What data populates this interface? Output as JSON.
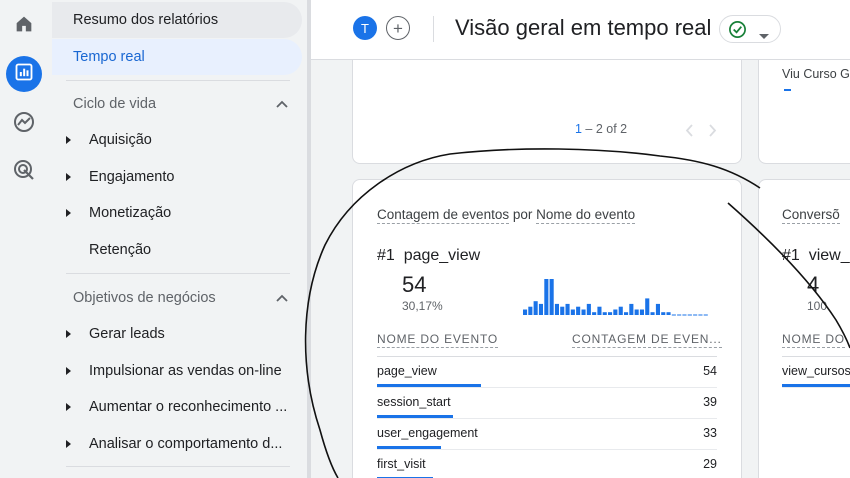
{
  "rail": {
    "items": [
      {
        "name": "home-icon",
        "active": false
      },
      {
        "name": "reports-icon",
        "active": true
      },
      {
        "name": "explore-icon",
        "active": false
      },
      {
        "name": "advertising-icon",
        "active": false
      }
    ]
  },
  "sidebar": {
    "top": [
      {
        "label": "Resumo dos relatórios"
      },
      {
        "label": "Tempo real"
      }
    ],
    "sections": [
      {
        "label": "Ciclo de vida",
        "items": [
          {
            "label": "Aquisição",
            "expandable": true
          },
          {
            "label": "Engajamento",
            "expandable": true
          },
          {
            "label": "Monetização",
            "expandable": true
          },
          {
            "label": "Retenção",
            "expandable": false
          }
        ]
      },
      {
        "label": "Objetivos de negócios",
        "items": [
          {
            "label": "Gerar leads",
            "expandable": true
          },
          {
            "label": "Impulsionar as vendas on-line",
            "expandable": true
          },
          {
            "label": "Aumentar o reconhecimento ...",
            "expandable": true
          },
          {
            "label": "Analisar o comportamento d...",
            "expandable": true
          }
        ]
      }
    ]
  },
  "header": {
    "avatar_letter": "T",
    "add_label": "+",
    "title": "Visão geral em tempo real"
  },
  "top_card": {
    "pager_current": "1",
    "pager_rest": " – 2 of 2"
  },
  "right_card_top": {
    "title": "Viu Curso G"
  },
  "events_card": {
    "title_part1": "Contagem de eventos",
    "title_part2": " por ",
    "title_part3": "Nome do evento",
    "rank": "#1",
    "top_event": "page_view",
    "top_count": "54",
    "top_pct": "30,17%",
    "col_name": "NOME DO EVENTO",
    "col_count": "CONTAGEM DE EVEN...",
    "rows": [
      {
        "name": "page_view",
        "count": "54",
        "share": 0.3
      },
      {
        "name": "session_start",
        "count": "39",
        "share": 0.22
      },
      {
        "name": "user_engagement",
        "count": "33",
        "share": 0.18
      },
      {
        "name": "first_visit",
        "count": "29",
        "share": 0.16
      }
    ],
    "sparkline": [
      2,
      3,
      5,
      4,
      13,
      13,
      4,
      3,
      4,
      2,
      3,
      2,
      4,
      1,
      3,
      1,
      1,
      2,
      3,
      1,
      4,
      2,
      2,
      6,
      1,
      4,
      1,
      1,
      0,
      0,
      0,
      0,
      0,
      0,
      0
    ]
  },
  "conversions_card": {
    "title": "Conversõ",
    "rank": "#1",
    "top_event": "view_",
    "top_count": "4",
    "top_pct": "100",
    "col_name": "NOME DO",
    "row_name": "view_cursos"
  },
  "colors": {
    "accent": "#1a73e8",
    "status_green": "#188038"
  }
}
